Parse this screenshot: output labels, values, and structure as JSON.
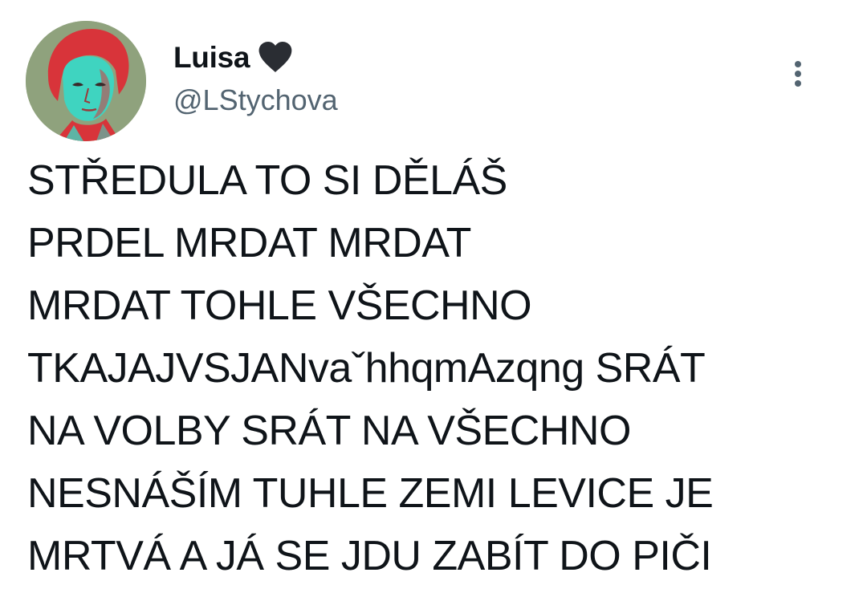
{
  "author": {
    "display_name": "Luisa",
    "handle": "@LStychova",
    "name_emoji": "black-heart-icon"
  },
  "menu": {
    "icon": "more-vertical-icon"
  },
  "tweet": {
    "text": "STŘEDULA TO SI DĚLÁŠ\nPRDEL MRDAT MRDAT\nMRDAT TOHLE VŠECHNO\nTKAJAJVSJANvaˇhhqmAzqng SRÁT\nNA VOLBY SRÁT NA VŠECHNO\nNESNÁŠÍM TUHLE ZEMI LEVICE JE\nMRTVÁ A JÁ SE JDU ZABÍT DO PIČI"
  },
  "colors": {
    "text": "#0f1419",
    "secondary_text": "#536471",
    "background": "#ffffff",
    "avatar_red": "#d8343a",
    "avatar_teal": "#3fd4c0",
    "avatar_bg": "#8fa27d"
  }
}
